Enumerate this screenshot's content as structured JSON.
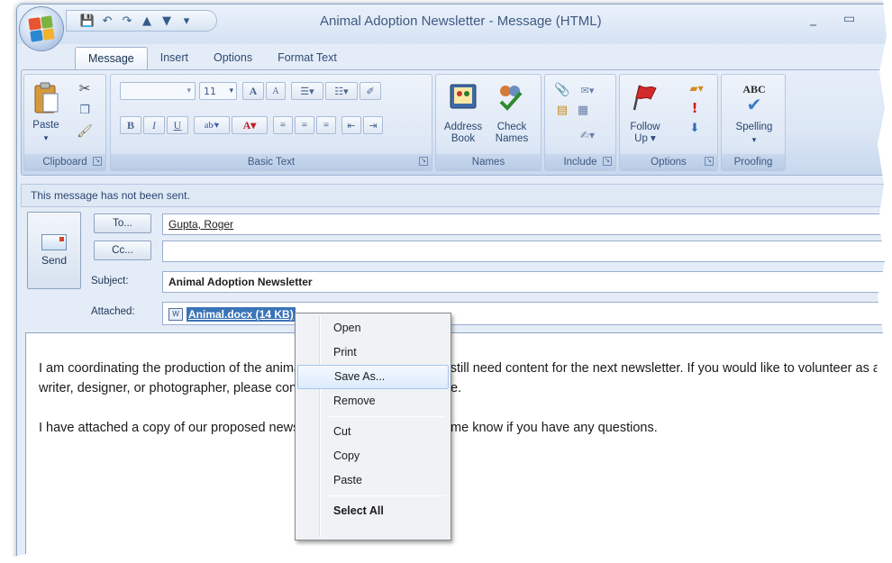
{
  "window": {
    "title": "Animal Adoption Newsletter - Message (HTML)",
    "minimize_glyph": "_",
    "maximize_glyph": "▭"
  },
  "quick_access": {
    "icons": [
      "save-icon",
      "undo-icon",
      "redo-icon",
      "up-arrow-icon",
      "down-arrow-icon",
      "customize-icon"
    ]
  },
  "tabs": [
    "Message",
    "Insert",
    "Options",
    "Format Text"
  ],
  "ribbon": {
    "clipboard": {
      "paste": "Paste",
      "label": "Clipboard"
    },
    "basic_text": {
      "font_size": "11",
      "grow": "A",
      "shrink": "A",
      "bold": "B",
      "italic": "I",
      "underline": "U",
      "label": "Basic Text"
    },
    "names": {
      "address_book_1": "Address",
      "address_book_2": "Book",
      "check_names_1": "Check",
      "check_names_2": "Names",
      "label": "Names"
    },
    "include": {
      "label": "Include"
    },
    "options": {
      "follow_up_1": "Follow",
      "follow_up_2": "Up ▾",
      "label": "Options"
    },
    "proofing": {
      "abc": "ABC",
      "spelling": "Spelling",
      "label": "Proofing"
    }
  },
  "infobar": "This message has not been sent.",
  "compose": {
    "send": "Send",
    "to_button": "To...",
    "cc_button": "Cc...",
    "subject_label": "Subject:",
    "attached_label": "Attached:",
    "to_value": "Gupta, Roger",
    "cc_value": "",
    "subject_value": "Animal Adoption Newsletter",
    "attachment": "Animal.docx (14 KB)",
    "attachment_icon_text": "W"
  },
  "body": {
    "line1": "I am coordinating the production of the animal adoption newsletter. We still need content for the next newsletter. If you would like to volunteer as a writer, designer, or photographer, please contact me as soon as possible.",
    "line2": "I have attached a copy of our proposed newsletter template. Please let me know if you have any questions."
  },
  "context_menu": {
    "items": [
      "Open",
      "Print",
      "Save As...",
      "Remove",
      "Cut",
      "Copy",
      "Paste",
      "Select All"
    ],
    "highlighted": "Save As..."
  },
  "colors": {
    "ribbon_blue": "#dbe6f5",
    "selection_blue": "#3a74b8",
    "office_logo": [
      "#e8542f",
      "#7cb33f",
      "#2a87d0",
      "#f2b22b"
    ]
  }
}
